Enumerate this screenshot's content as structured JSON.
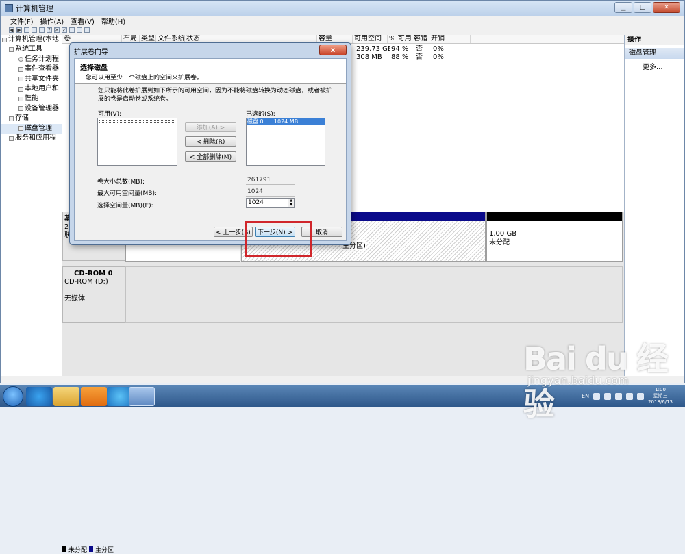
{
  "window": {
    "title": "计算机管理"
  },
  "menu": [
    "文件(F)",
    "操作(A)",
    "查看(V)",
    "帮助(H)"
  ],
  "tree": {
    "items": [
      {
        "label": "计算机管理(本地",
        "level": 0
      },
      {
        "label": "系统工具",
        "level": 1
      },
      {
        "label": "任务计划程",
        "level": 2
      },
      {
        "label": "事件查看器",
        "level": 2
      },
      {
        "label": "共享文件夹",
        "level": 2
      },
      {
        "label": "本地用户和",
        "level": 2
      },
      {
        "label": "性能",
        "level": 2
      },
      {
        "label": "设备管理器",
        "level": 2
      },
      {
        "label": "存储",
        "level": 1
      },
      {
        "label": "磁盘管理",
        "level": 2
      },
      {
        "label": "服务和应用程",
        "level": 1
      }
    ]
  },
  "volumes": {
    "headers": [
      "卷",
      "布局",
      "类型",
      "文件系统",
      "状态",
      "容量",
      "可用空间",
      "% 可用",
      "容错",
      "开销"
    ],
    "rows": [
      {
        "free": "239.73 GB",
        "pct": "94 %",
        "fault": "否",
        "overhead": "0%"
      },
      {
        "free": "308 MB",
        "pct": "88 %",
        "fault": "否",
        "overhead": "0%"
      }
    ]
  },
  "disks": {
    "disk0": {
      "label_lines": [
        "基",
        "25",
        "联"
      ],
      "part_text": "主分区)",
      "unalloc_size": "1.00 GB",
      "unalloc_label": "未分配"
    },
    "cdrom": {
      "name": "CD-ROM 0",
      "type": "CD-ROM (D:)",
      "status": "无媒体"
    }
  },
  "legend": {
    "unallocated": "未分配",
    "primary": "主分区"
  },
  "actions": {
    "title": "操作",
    "section": "磁盘管理",
    "more": "更多..."
  },
  "wizard": {
    "title": "扩展卷向导",
    "close": "x",
    "head_title": "选择磁盘",
    "head_sub": "您可以用至少一个磁盘上的空间来扩展卷。",
    "desc": "您只能将此卷扩展到如下所示的可用空间，因为不能将磁盘转换为动态磁盘，或者被扩展的卷是启动卷或系统卷。",
    "available_label": "可用(V):",
    "selected_label": "已选的(S):",
    "selected_item": "磁盘 0      1024 MB",
    "add_button": "添加(A) >",
    "remove_button": "< 删除(R)",
    "remove_all_button": "< 全部删除(M)",
    "total_label": "卷大小总数(MB):",
    "total_value": "261791",
    "max_label": "最大可用空间量(MB):",
    "max_value": "1024",
    "select_label": "选择空间量(MB)(E):",
    "select_value": "1024",
    "back_button": "< 上一步(B)",
    "next_button": "下一步(N) >",
    "cancel_button": "取消"
  },
  "taskbar": {
    "lang": "EN",
    "time": "1:00",
    "day": "星期三",
    "date": "2018/6/13"
  },
  "watermark": {
    "main": "Bai du 经验",
    "url": "jingyan.baidu.com"
  },
  "colors": {
    "primary_partition": "#0a0a8a",
    "unallocated": "#000000",
    "highlight": "#d0262b"
  }
}
